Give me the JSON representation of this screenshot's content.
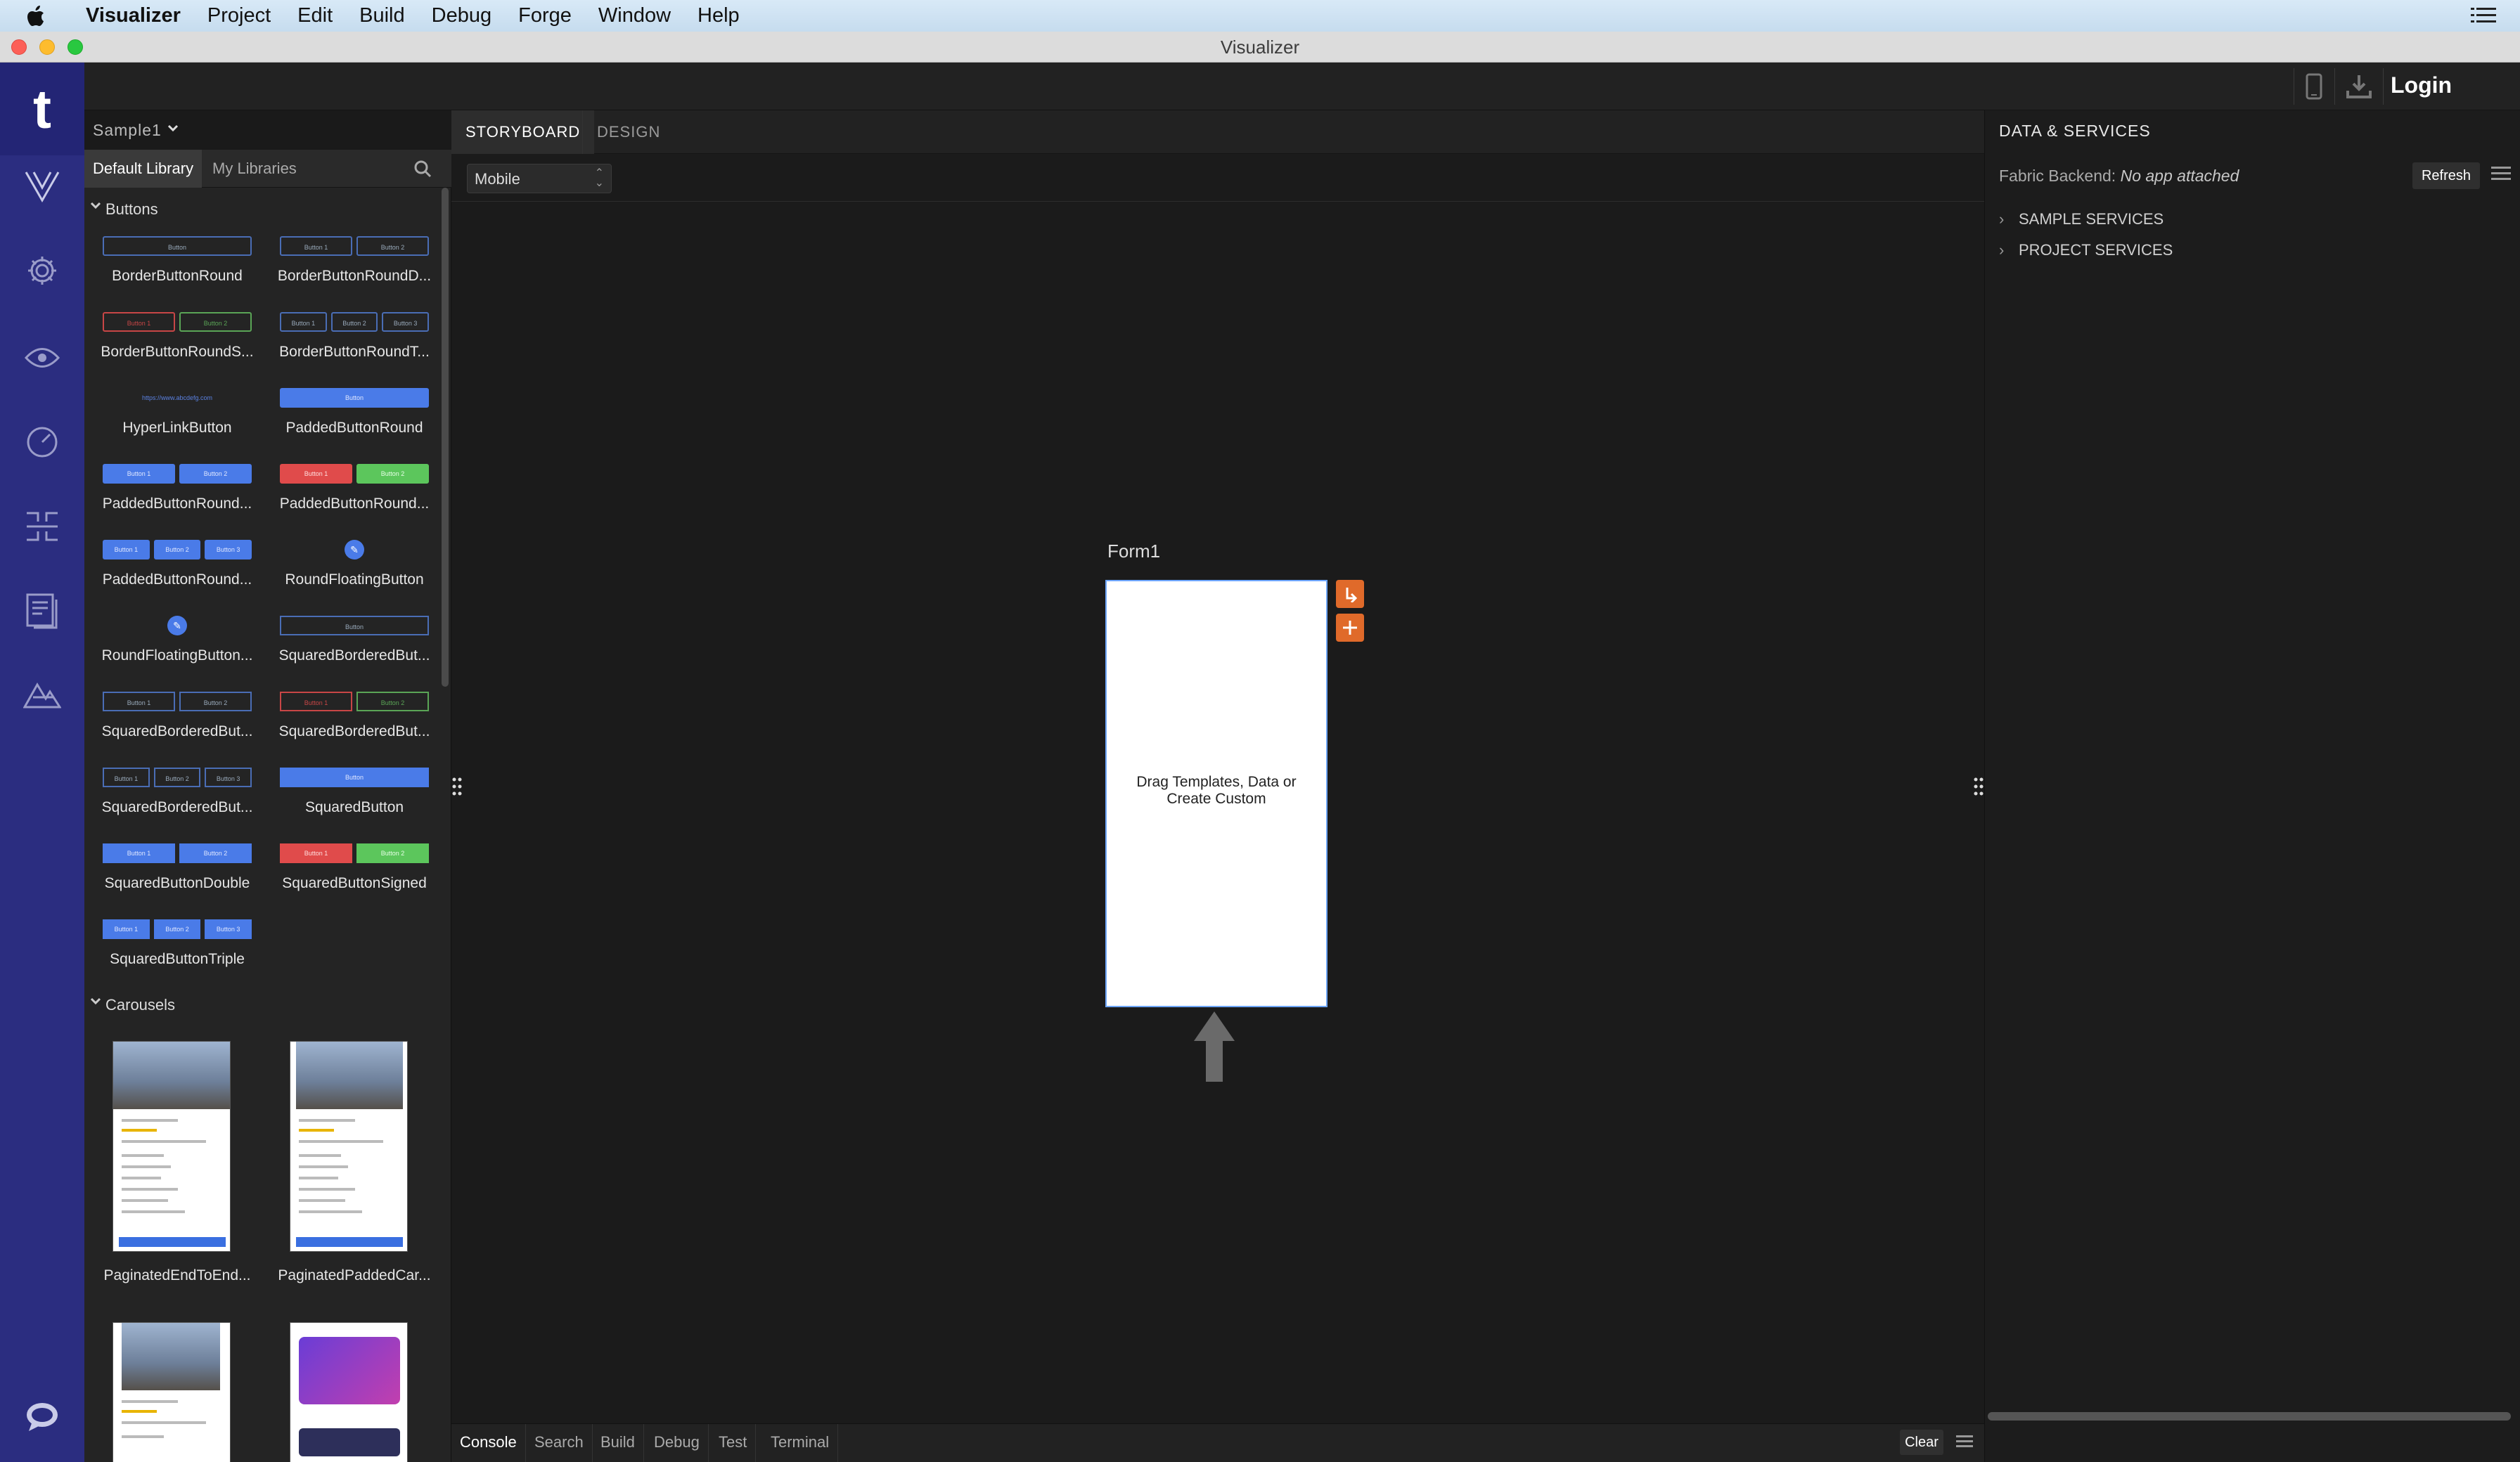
{
  "menubar": {
    "app_name": "Visualizer",
    "items": [
      "Project",
      "Edit",
      "Build",
      "Debug",
      "Forge",
      "Window",
      "Help"
    ]
  },
  "window": {
    "title": "Visualizer"
  },
  "rail": {
    "logo": "t"
  },
  "topbar": {
    "login_label": "Login"
  },
  "library": {
    "project_name": "Sample1",
    "tabs": {
      "default": "Default Library",
      "mine": "My Libraries"
    },
    "sections": {
      "buttons": "Buttons",
      "carousels": "Carousels"
    },
    "buttons": [
      "BorderButtonRound",
      "BorderButtonRoundD...",
      "BorderButtonRoundS...",
      "BorderButtonRoundT...",
      "HyperLinkButton",
      "PaddedButtonRound",
      "PaddedButtonRound...",
      "PaddedButtonRound...",
      "PaddedButtonRound...",
      "RoundFloatingButton",
      "RoundFloatingButton...",
      "SquaredBorderedBut...",
      "SquaredBorderedBut...",
      "SquaredBorderedBut...",
      "SquaredBorderedBut...",
      "SquaredButton",
      "SquaredButtonDouble",
      "SquaredButtonSigned",
      "SquaredButtonTriple"
    ],
    "preview_labels": {
      "button": "Button",
      "b1": "Button 1",
      "b2": "Button 2",
      "b3": "Button 3",
      "link": "https://www.abcdefg.com"
    },
    "carousels": [
      "PaginatedEndToEnd...",
      "PaginatedPaddedCar..."
    ]
  },
  "canvas": {
    "tabs": {
      "storyboard": "STORYBOARD",
      "design": "DESIGN"
    },
    "mode": "Mobile",
    "form_name": "Form1",
    "form_hint_line1": "Drag Templates, Data or",
    "form_hint_line2": "Create Custom"
  },
  "services": {
    "title": "DATA & SERVICES",
    "backend_label": "Fabric Backend:",
    "backend_value": "No app attached",
    "refresh_label": "Refresh",
    "tree": [
      "SAMPLE SERVICES",
      "PROJECT SERVICES"
    ]
  },
  "bottom": {
    "tabs": [
      "Console",
      "Search",
      "Build",
      "Debug",
      "Test",
      "Terminal"
    ],
    "clear_label": "Clear"
  },
  "colors": {
    "rail": "#2b2d80",
    "accent_orange": "#e06a2a",
    "selection_blue": "#6ea6ff"
  }
}
